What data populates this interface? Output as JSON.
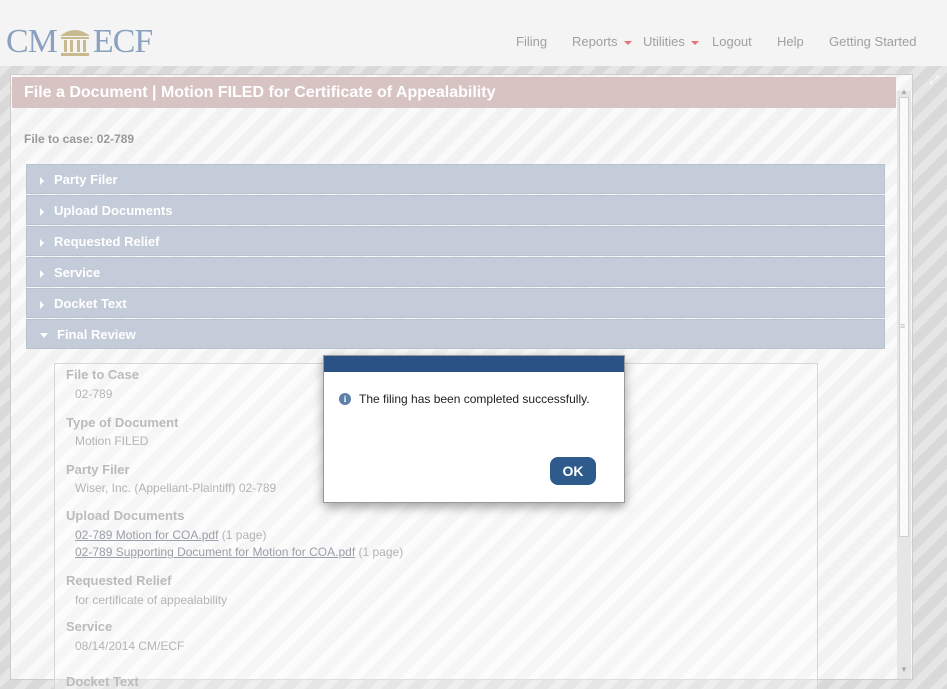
{
  "header": {
    "logo_left": "CM",
    "logo_right": "ECF",
    "nav": [
      {
        "label": "Filing",
        "dropdown": false
      },
      {
        "label": "Reports",
        "dropdown": true
      },
      {
        "label": "Utilities",
        "dropdown": true
      },
      {
        "label": "Logout",
        "dropdown": false
      },
      {
        "label": "Help",
        "dropdown": false
      },
      {
        "label": "Getting Started",
        "dropdown": false
      }
    ]
  },
  "window": {
    "title": "File a Document | Motion FILED for Certificate of Appealability",
    "case_line": "File to case: 02-789",
    "sections": [
      {
        "label": "Party Filer",
        "expanded": false
      },
      {
        "label": "Upload Documents",
        "expanded": false
      },
      {
        "label": "Requested Relief",
        "expanded": false
      },
      {
        "label": "Service",
        "expanded": false
      },
      {
        "label": "Docket Text",
        "expanded": false
      },
      {
        "label": "Final Review",
        "expanded": true
      }
    ]
  },
  "review": {
    "file_to_case": {
      "heading": "File to Case",
      "value": "02-789"
    },
    "type_of_document": {
      "heading": "Type of Document",
      "value": "Motion FILED"
    },
    "party_filer": {
      "heading": "Party Filer",
      "value": "Wiser, Inc. (Appellant-Plaintiff) 02-789"
    },
    "upload_documents": {
      "heading": "Upload Documents",
      "files": [
        {
          "name": "02-789 Motion for COA.pdf",
          "pages": "(1 page)"
        },
        {
          "name": "02-789 Supporting Document for Motion for COA.pdf",
          "pages": "(1 page)"
        }
      ]
    },
    "requested_relief": {
      "heading": "Requested Relief",
      "value": "for certificate of appealability"
    },
    "service": {
      "heading": "Service",
      "value": "08/14/2014 CM/ECF"
    },
    "docket_text": {
      "heading": "Docket Text"
    }
  },
  "modal": {
    "message": "The filing has been completed successfully.",
    "ok_label": "OK",
    "icon": "info-icon"
  },
  "colors": {
    "title_bar": "#d8c3c3",
    "accordion": "#c3ccd8",
    "modal_bar": "#2a5285",
    "ok_button": "#2e5a8c",
    "nav_caret": "#e57373"
  }
}
